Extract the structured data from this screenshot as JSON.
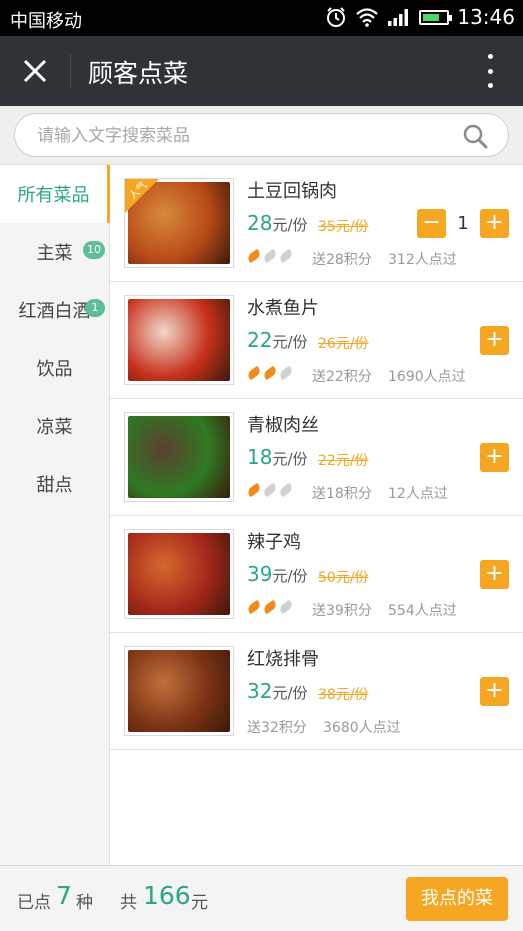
{
  "statusbar": {
    "carrier": "中国移动",
    "time": "13:46"
  },
  "titlebar": {
    "title": "顾客点菜"
  },
  "search": {
    "placeholder": "请输入文字搜索菜品"
  },
  "categories": [
    {
      "label": "所有菜品",
      "badge": ""
    },
    {
      "label": "主菜",
      "badge": "10"
    },
    {
      "label": "红酒白酒",
      "badge": "1"
    },
    {
      "label": "饮品",
      "badge": ""
    },
    {
      "label": "凉菜",
      "badge": ""
    },
    {
      "label": "甜点",
      "badge": ""
    }
  ],
  "dishes": [
    {
      "name": "土豆回锅肉",
      "price": "28",
      "unit": "元/份",
      "old_price": "35元/份",
      "spicy": 1,
      "points": "送28积分",
      "served": "312人点过",
      "ribbon": "人气",
      "qty": "1",
      "colors": [
        "#b84a18",
        "#d88a3a"
      ]
    },
    {
      "name": "水煮鱼片",
      "price": "22",
      "unit": "元/份",
      "old_price": "26元/份",
      "spicy": 2,
      "points": "送22积分",
      "served": "1690人点过",
      "colors": [
        "#c8301c",
        "#f0d8c8"
      ]
    },
    {
      "name": "青椒肉丝",
      "price": "18",
      "unit": "元/份",
      "old_price": "22元/份",
      "spicy": 1,
      "points": "送18积分",
      "served": "12人点过",
      "colors": [
        "#2f7a22",
        "#5a4030"
      ]
    },
    {
      "name": "辣子鸡",
      "price": "39",
      "unit": "元/份",
      "old_price": "50元/份",
      "spicy": 2,
      "points": "送39积分",
      "served": "554人点过",
      "colors": [
        "#a4271a",
        "#d46a30"
      ]
    },
    {
      "name": "红烧排骨",
      "price": "32",
      "unit": "元/份",
      "old_price": "38元/份",
      "spicy": 0,
      "points": "送32积分",
      "served": "3680人点过",
      "colors": [
        "#7a3214",
        "#c0703a"
      ]
    }
  ],
  "footer": {
    "ordered_prefix": "已点",
    "ordered_count": "7",
    "ordered_suffix": "种",
    "total_prefix": "共",
    "total_amount": "166",
    "total_suffix": "元",
    "button": "我点的菜"
  },
  "accent_color": "#2aa58a",
  "button_color": "#f5a623"
}
